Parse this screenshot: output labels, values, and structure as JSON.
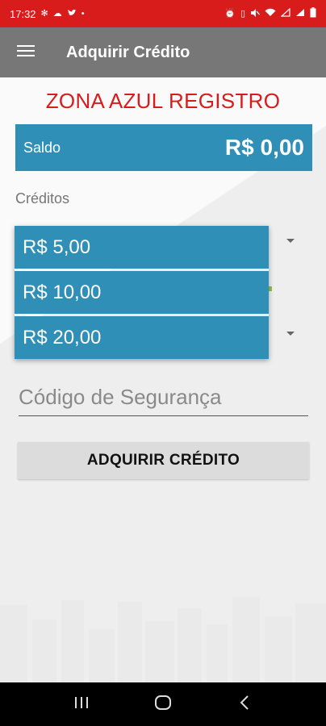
{
  "status_bar": {
    "time": "17:32",
    "icons_left": [
      "settings-icon",
      "cloud-icon",
      "twitter-icon",
      "dot-icon"
    ],
    "icons_right": [
      "alarm-icon",
      "vibrate-icon",
      "mute-icon",
      "wifi-icon",
      "signal-icon",
      "signal-icon",
      "battery-icon"
    ],
    "background_color": "#d81b1b"
  },
  "app_bar": {
    "menu_icon": "hamburger-menu-icon",
    "title": "Adquirir Crédito",
    "background_color": "#777777"
  },
  "brand": {
    "title": "ZONA AZUL REGISTRO",
    "color": "#d81b1b"
  },
  "balance": {
    "label": "Saldo",
    "value": "R$ 0,00",
    "background_color": "#2f8fb7"
  },
  "credits": {
    "label": "Créditos",
    "options": [
      "R$ 5,00",
      "R$ 10,00",
      "R$ 20,00"
    ]
  },
  "security_code": {
    "placeholder": "Código de Segurança",
    "value": ""
  },
  "buy_button": {
    "label": "ADQUIRIR CRÉDITO"
  },
  "nav_bar": {
    "buttons": [
      "recent-apps-icon",
      "home-icon",
      "back-icon"
    ]
  }
}
